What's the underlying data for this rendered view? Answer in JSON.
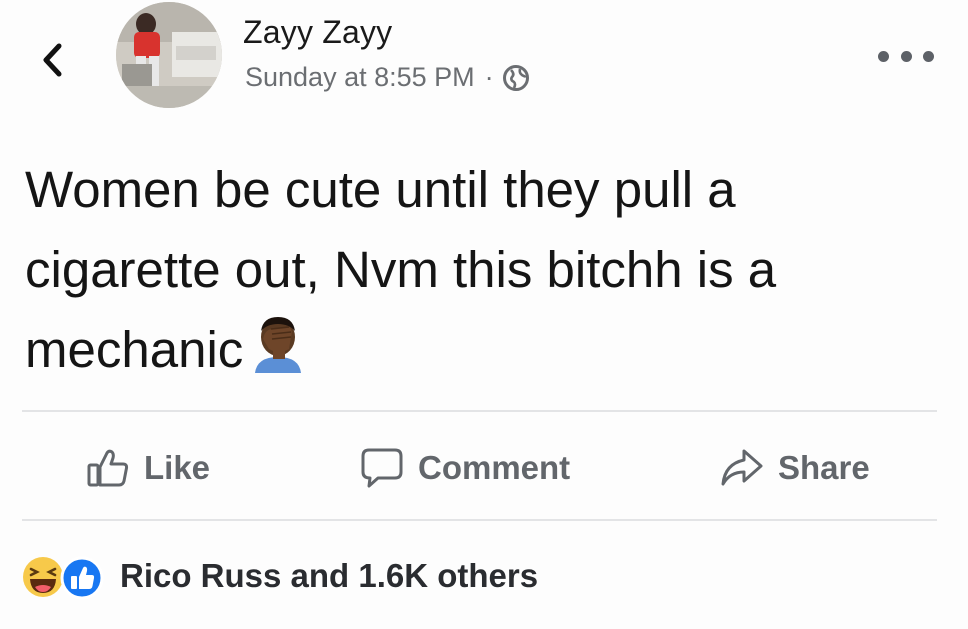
{
  "header": {
    "author_name": "Zayy Zayy",
    "timestamp": "Sunday at 8:55 PM",
    "separator": "·",
    "privacy_icon": "globe-icon",
    "back_icon": "chevron-left-icon",
    "more_icon": "more-horizontal-icon"
  },
  "post": {
    "lines": [
      "Women be cute until they pull a",
      "cigarette out, Nvm this bitchh is a",
      "mechanic"
    ],
    "emoji": "man-facepalming-emoji"
  },
  "actions": [
    {
      "label": "Like",
      "icon": "thumbs-up-outline-icon"
    },
    {
      "label": "Comment",
      "icon": "comment-bubble-icon"
    },
    {
      "label": "Share",
      "icon": "share-arrow-icon"
    }
  ],
  "reactions": {
    "icons": [
      "haha-reaction-icon",
      "like-reaction-icon"
    ],
    "summary": "Rico Russ and 1.6K others"
  },
  "colors": {
    "text": "#151515",
    "meta": "#6b6e72",
    "action_text": "#62666b",
    "like_blue": "#1877f2",
    "haha_yellow": "#f7c94a",
    "divider": "#e3e4e6"
  }
}
